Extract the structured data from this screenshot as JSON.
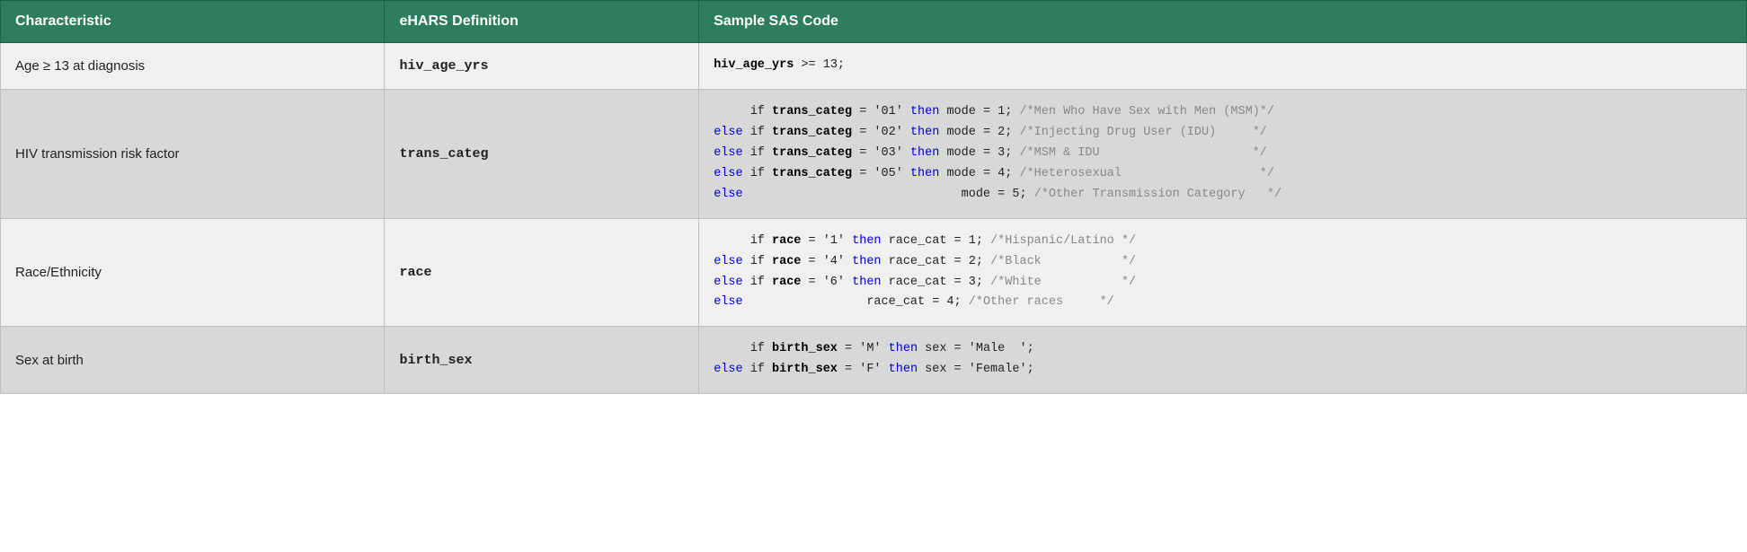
{
  "table": {
    "headers": {
      "characteristic": "Characteristic",
      "ehars": "eHARS Definition",
      "sas": "Sample SAS Code"
    },
    "rows": [
      {
        "characteristic": "Age ≥ 13 at diagnosis",
        "ehars": "hiv_age_yrs",
        "sas_html": "<span class='kw-bold'>hiv_age_yrs</span> >= 13;"
      },
      {
        "characteristic": "HIV transmission risk factor",
        "ehars": "trans_categ",
        "sas_html": "     if <span class='kw-bold'>trans_categ</span> = '01' <span class='kw-blue'>then</span> mode = 1; <span class='comment'>/*Men Who Have Sex with Men (MSM)*/</span>\n<span class='kw-blue'>else</span> if <span class='kw-bold'>trans_categ</span> = '02' <span class='kw-blue'>then</span> mode = 2; <span class='comment'>/*Injecting Drug User (IDU)     */</span>\n<span class='kw-blue'>else</span> if <span class='kw-bold'>trans_categ</span> = '03' <span class='kw-blue'>then</span> mode = 3; <span class='comment'>/*MSM &amp; IDU                     */</span>\n<span class='kw-blue'>else</span> if <span class='kw-bold'>trans_categ</span> = '05' <span class='kw-blue'>then</span> mode = 4; <span class='comment'>/*Heterosexual                   */</span>\n<span class='kw-blue'>else</span>                              mode = 5; <span class='comment'>/*Other Transmission Category   */</span>"
      },
      {
        "characteristic": "Race/Ethnicity",
        "ehars": "race",
        "sas_html": "     if <span class='kw-bold'>race</span> = '1' <span class='kw-blue'>then</span> race_cat = 1; <span class='comment'>/*Hispanic/Latino */</span>\n<span class='kw-blue'>else</span> if <span class='kw-bold'>race</span> = '4' <span class='kw-blue'>then</span> race_cat = 2; <span class='comment'>/*Black           */</span>\n<span class='kw-blue'>else</span> if <span class='kw-bold'>race</span> = '6' <span class='kw-blue'>then</span> race_cat = 3; <span class='comment'>/*White           */</span>\n<span class='kw-blue'>else</span>                 race_cat = 4; <span class='comment'>/*Other races     */</span>"
      },
      {
        "characteristic": "Sex at birth",
        "ehars": "birth_sex",
        "sas_html": "     if <span class='kw-bold'>birth_sex</span> = 'M' <span class='kw-blue'>then</span> sex = 'Male  ';\n<span class='kw-blue'>else</span> if <span class='kw-bold'>birth_sex</span> = 'F' <span class='kw-blue'>then</span> sex = 'Female';"
      }
    ]
  }
}
